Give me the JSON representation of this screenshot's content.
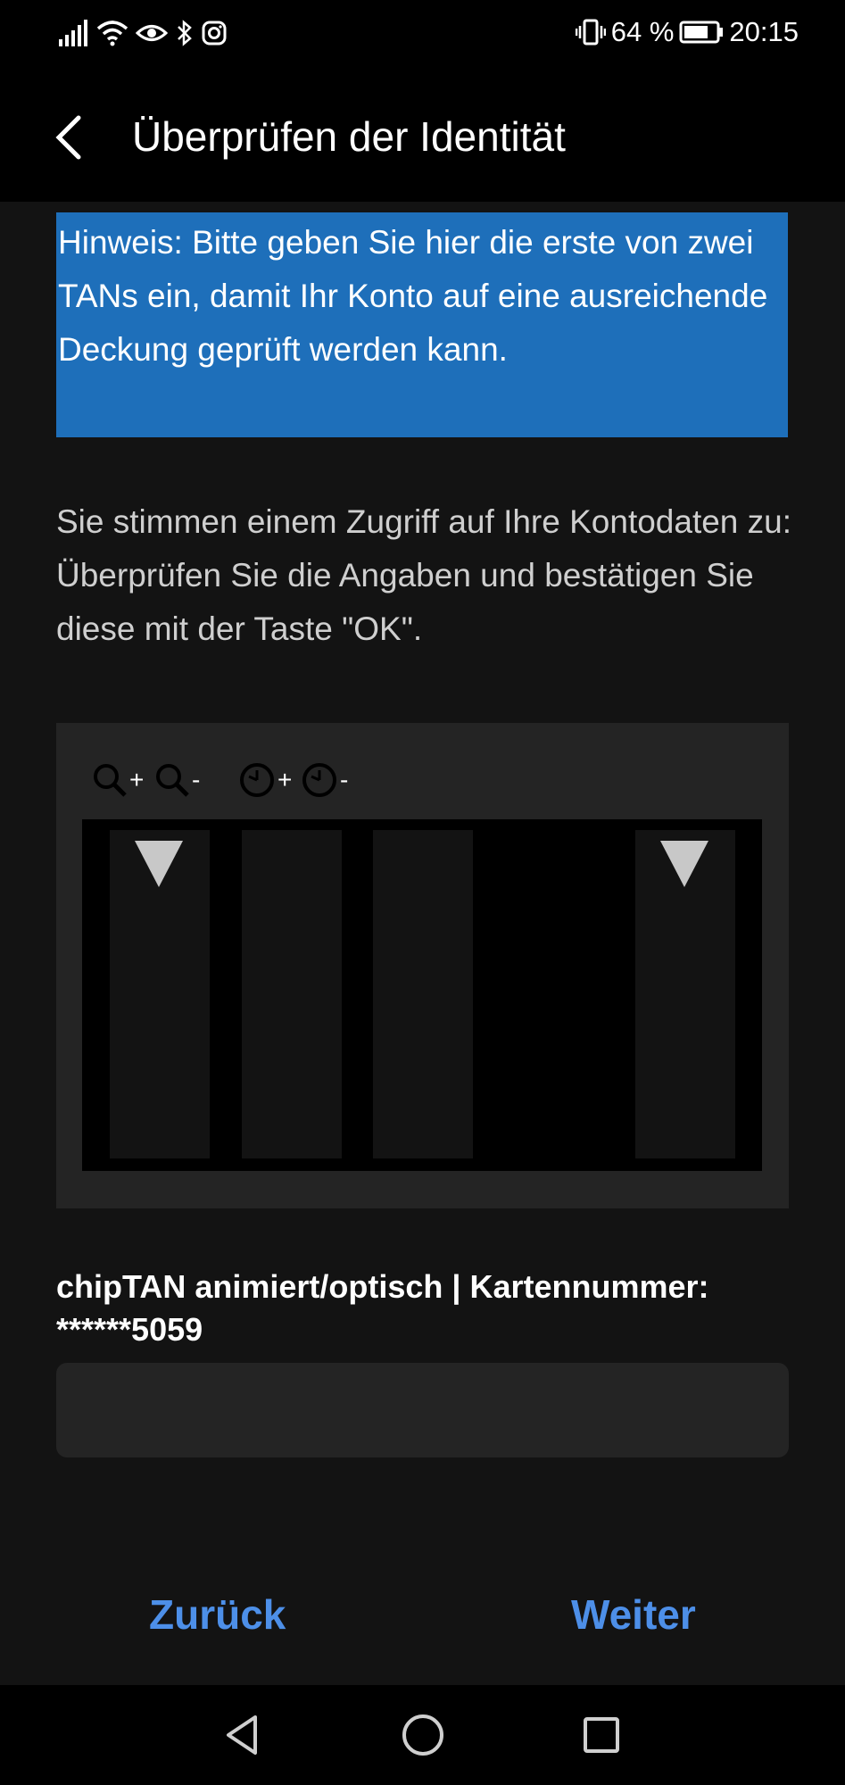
{
  "status_bar": {
    "battery": "64 %",
    "time": "20:15",
    "icons": [
      "signal-icon",
      "wifi-icon",
      "eye-icon",
      "bluetooth-icon",
      "instagram-icon",
      "vibrate-icon",
      "battery-icon"
    ]
  },
  "app_bar": {
    "title": "Überprüfen der Identität"
  },
  "hint": {
    "text": "Hinweis: Bitte geben Sie hier die erste von zwei TANs ein, damit Ihr Konto auf eine ausreichende Deckung geprüft werden kann."
  },
  "consent": {
    "text": "Sie stimmen einem Zugriff auf Ihre Kontodaten zu: Überprüfen Sie die Angaben und bestätigen Sie diese mit der Taste \"OK\"."
  },
  "flicker_controls": {
    "zoom_in": "+",
    "zoom_out": "-",
    "speed_up": "+",
    "speed_down": "-"
  },
  "tan": {
    "label": "chipTAN animiert/optisch | Kartennummer: ******5059",
    "value": "",
    "placeholder": ""
  },
  "buttons": {
    "back": "Zurück",
    "next": "Weiter"
  },
  "colors": {
    "hint_bg": "#1e6fba",
    "accent": "#4d8fe8",
    "background": "#131313"
  }
}
